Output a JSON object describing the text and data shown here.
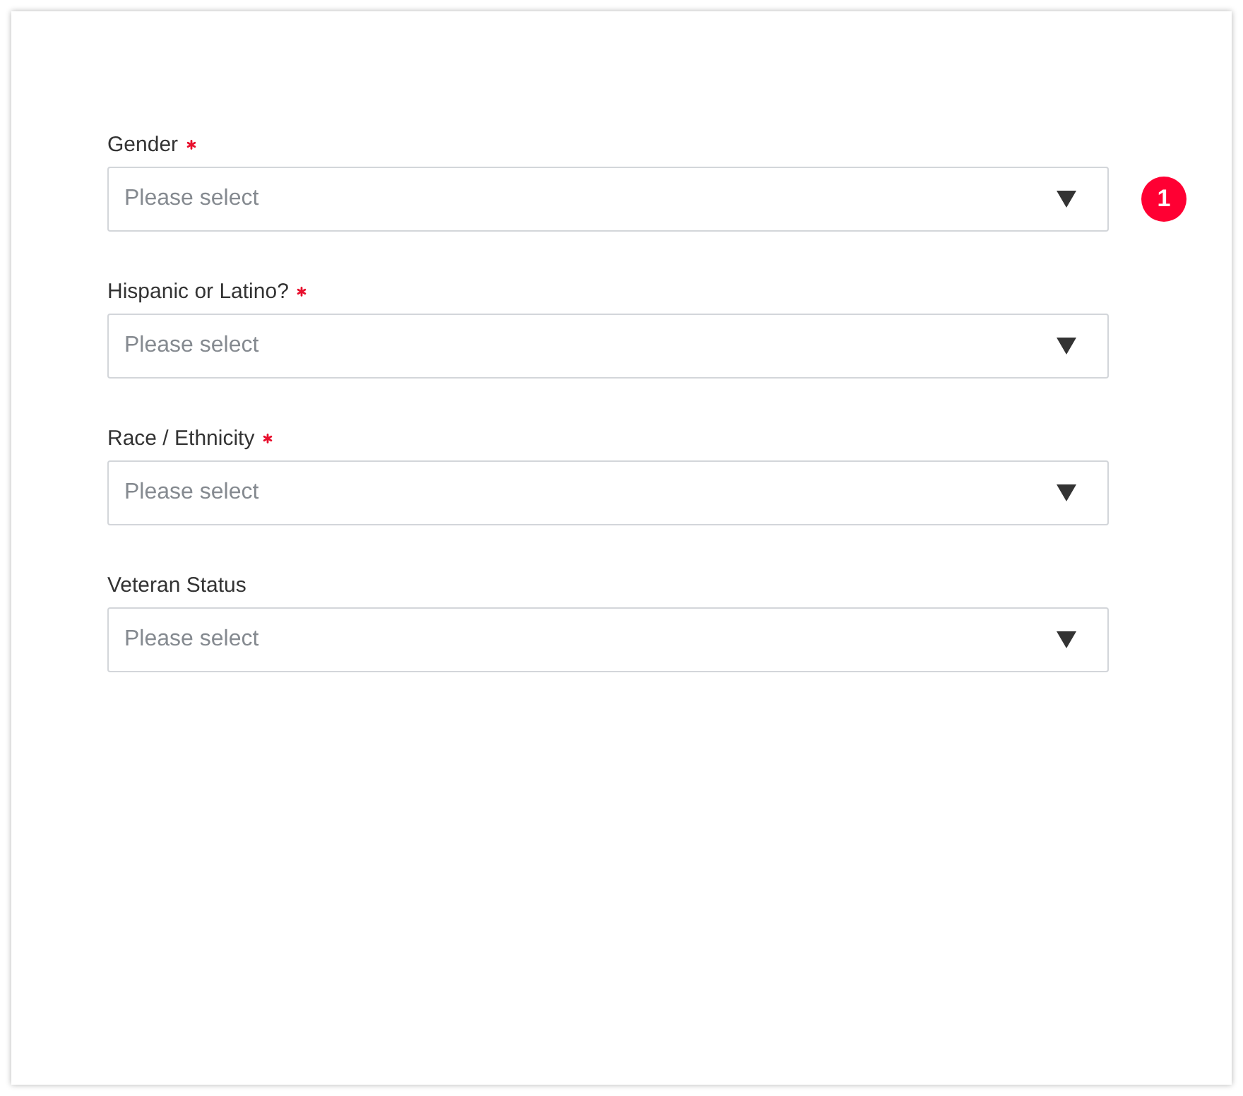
{
  "fields": [
    {
      "label": "Gender",
      "required": true,
      "placeholder": "Please select",
      "badge": "1"
    },
    {
      "label": "Hispanic or Latino?",
      "required": true,
      "placeholder": "Please select"
    },
    {
      "label": "Race / Ethnicity",
      "required": true,
      "placeholder": "Please select"
    },
    {
      "label": "Veteran Status",
      "required": false,
      "placeholder": "Please select"
    }
  ]
}
